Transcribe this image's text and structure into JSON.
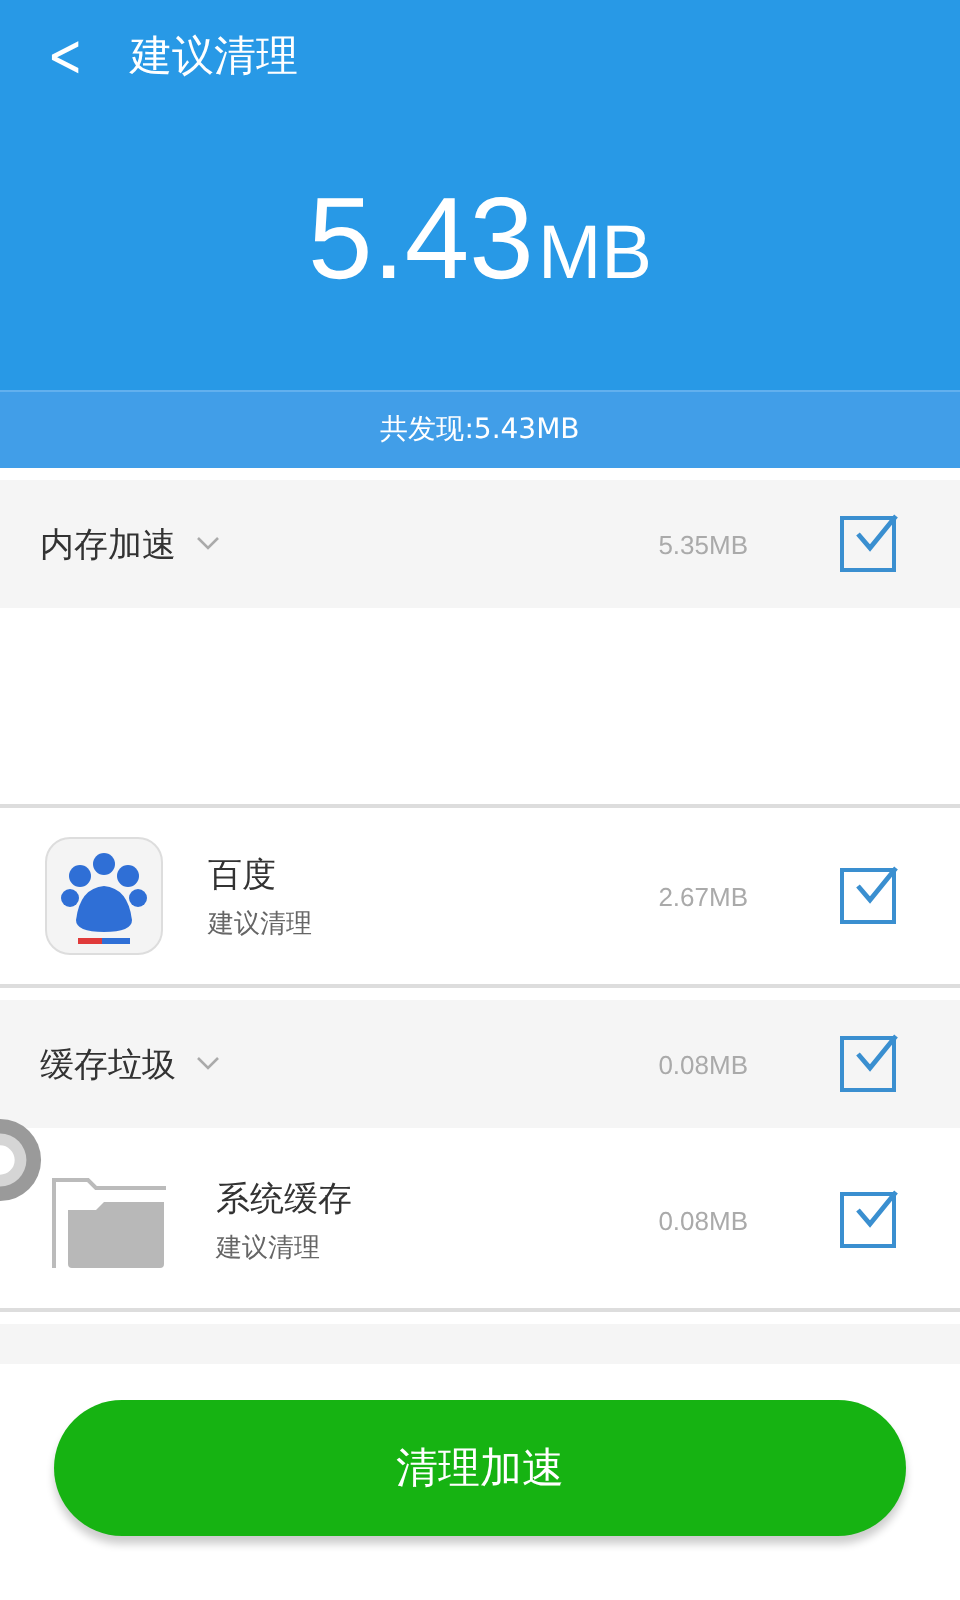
{
  "header": {
    "back": "<",
    "title": "建议清理",
    "amount": "5.43",
    "unit": "MB"
  },
  "summary": "共发现:5.43MB",
  "list": [
    {
      "kind": "section",
      "label": "内存加速",
      "size": "5.35MB",
      "checked": true
    },
    {
      "kind": "blank"
    },
    {
      "kind": "app",
      "name": "百度",
      "note": "建议清理",
      "size": "2.67MB",
      "checked": true
    },
    {
      "kind": "section",
      "label": "缓存垃圾",
      "size": "0.08MB",
      "checked": true
    },
    {
      "kind": "cache",
      "name": "系统缓存",
      "note": "建议清理",
      "size": "0.08MB",
      "checked": true
    },
    {
      "kind": "strip"
    }
  ],
  "action": "清理加速"
}
